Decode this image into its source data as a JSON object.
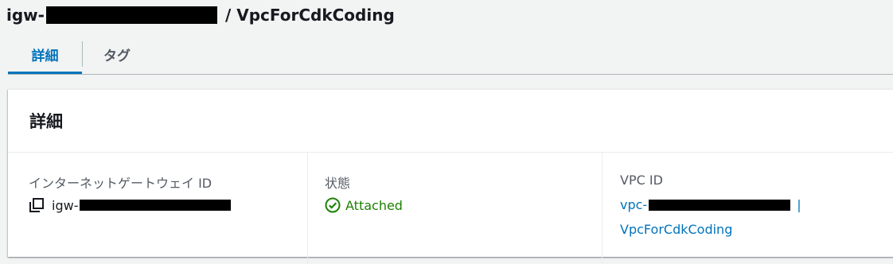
{
  "header": {
    "title_prefix": "igw-",
    "title_suffix": "/ VpcForCdkCoding"
  },
  "tabs": [
    {
      "label": "詳細",
      "active": true
    },
    {
      "label": "タグ",
      "active": false
    }
  ],
  "panel": {
    "title": "詳細",
    "fields": {
      "igw_id": {
        "label": "インターネットゲートウェイ ID",
        "value_prefix": "igw-",
        "icon": "copy-icon"
      },
      "state": {
        "label": "状態",
        "value": "Attached",
        "icon": "check-circle-icon",
        "color": "#1d8102"
      },
      "vpc_id": {
        "label": "VPC ID",
        "value_prefix": "vpc-",
        "separator": "|",
        "vpc_name": "VpcForCdkCoding",
        "color": "#0073bb"
      }
    }
  },
  "colors": {
    "accent": "#0073bb",
    "success": "#1d8102",
    "background": "#f2f3f3"
  }
}
